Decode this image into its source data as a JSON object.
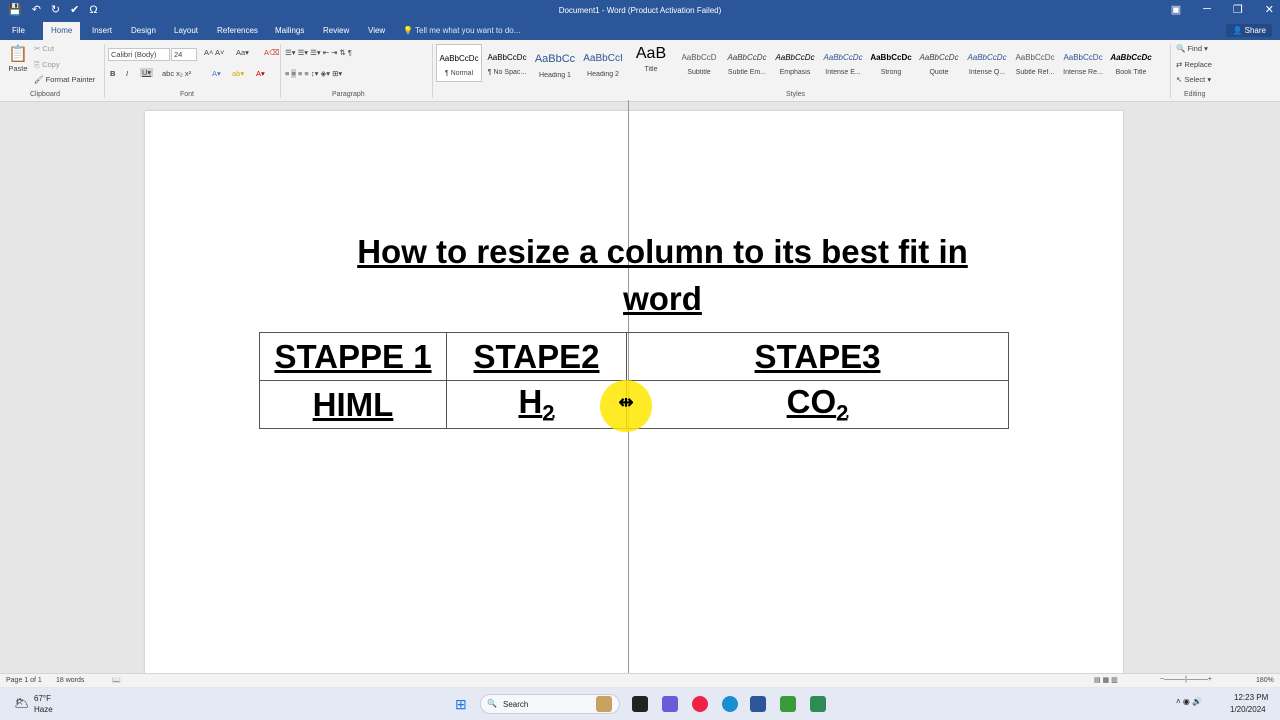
{
  "window": {
    "title": "Document1 - Word (Product Activation Failed)"
  },
  "tabs": [
    "File",
    "Home",
    "Insert",
    "Design",
    "Layout",
    "References",
    "Mailings",
    "Review",
    "View"
  ],
  "tell_me": "Tell me what you want to do...",
  "share": "Share",
  "clipboard": {
    "paste": "Paste",
    "cut": "Cut",
    "copy": "Copy",
    "format_painter": "Format Painter",
    "label": "Clipboard"
  },
  "font": {
    "name": "Calibri (Body)",
    "size": "24",
    "label": "Font"
  },
  "paragraph": {
    "label": "Paragraph"
  },
  "styles": {
    "label": "Styles",
    "items": [
      {
        "preview": "AaBbCcDc",
        "name": "¶ Normal"
      },
      {
        "preview": "AaBbCcDc",
        "name": "¶ No Spac..."
      },
      {
        "preview": "AaBbCc",
        "name": "Heading 1"
      },
      {
        "preview": "AaBbCcI",
        "name": "Heading 2"
      },
      {
        "preview": "AaB",
        "name": "Title"
      },
      {
        "preview": "AaBbCcD",
        "name": "Subtitle"
      },
      {
        "preview": "AaBbCcDc",
        "name": "Subtle Em..."
      },
      {
        "preview": "AaBbCcDc",
        "name": "Emphasis"
      },
      {
        "preview": "AaBbCcDc",
        "name": "Intense E..."
      },
      {
        "preview": "AaBbCcDc",
        "name": "Strong"
      },
      {
        "preview": "AaBbCcDc",
        "name": "Quote"
      },
      {
        "preview": "AaBbCcDc",
        "name": "Intense Q..."
      },
      {
        "preview": "AaBbCcDc",
        "name": "Subtle Ref..."
      },
      {
        "preview": "AaBbCcDc",
        "name": "Intense Re..."
      },
      {
        "preview": "AaBbCcDc",
        "name": "Book Title"
      }
    ]
  },
  "editing": {
    "find": "Find",
    "replace": "Replace",
    "select": "Select",
    "label": "Editing"
  },
  "document": {
    "heading": "How to resize a column to its best fit in word",
    "table": {
      "row1": [
        "STAPPE 1",
        "STAPE2",
        "STAPE3"
      ],
      "row2": {
        "c1": "HIML",
        "c2": "H",
        "c2_sub": "2",
        "c3": "CO",
        "c3_sub": "2"
      }
    }
  },
  "status": {
    "page": "Page 1 of 1",
    "words": "18 words",
    "zoom": "180%"
  },
  "taskbar": {
    "weather_temp": "67°F",
    "weather_desc": "Haze",
    "search": "Search",
    "time": "12:23 PM",
    "date": "1/20/2024"
  }
}
